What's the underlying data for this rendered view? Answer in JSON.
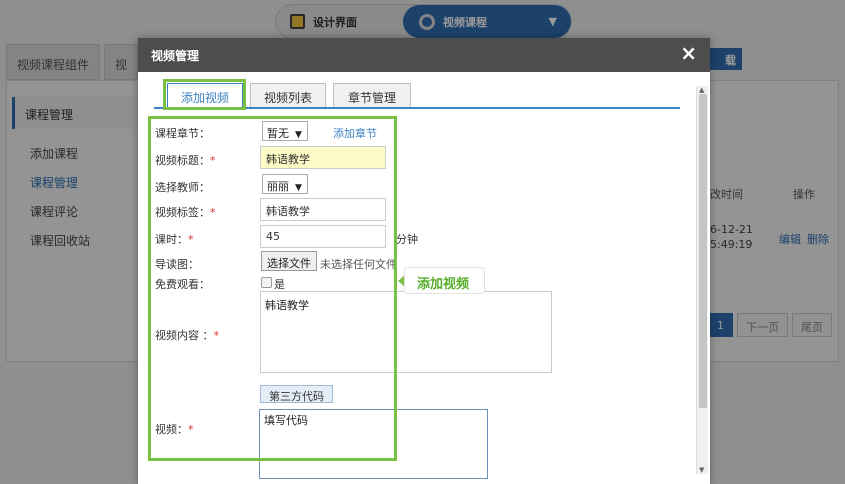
{
  "topbar": {
    "design_label": "设计界面",
    "course_label": "视频课程"
  },
  "bg": {
    "tabs": [
      "视频课程组件",
      "视"
    ],
    "download_label": "载",
    "sidebar_title": "课程管理",
    "sidebar_items": [
      "添加课程",
      "课程管理",
      "课程评论",
      "课程回收站"
    ],
    "col_time": "改时间",
    "col_ops": "操作",
    "row_date1": "6-12-21",
    "row_date2": "5:49:19",
    "edit": "编辑",
    "delete": "删除",
    "page_current": "1",
    "next": "下一页",
    "last": "尾页"
  },
  "modal": {
    "title": "视频管理",
    "close": "×",
    "tabs": [
      "添加视频",
      "视频列表",
      "章节管理"
    ]
  },
  "form": {
    "chapter_label": "课程章节：",
    "chapter_value": "暂无",
    "add_chapter": "添加章节",
    "title_label": "视频标题：",
    "title_value": "韩语教学",
    "teacher_label": "选择教师：",
    "teacher_value": "丽丽",
    "tags_label": "视频标签：",
    "tags_value": "韩语教学",
    "hours_label": "课时：",
    "hours_value": "45",
    "hours_unit": "分钟",
    "cover_label": "导读图：",
    "file_button": "选择文件",
    "file_none": "未选择任何文件",
    "free_label": "免费观看：",
    "free_option": "是",
    "content_label": "视频内容 ：",
    "content_value": "韩语教学",
    "code_button": "第三方代码",
    "video_label": "视频：",
    "video_value": "填写代码",
    "required_mark": "*"
  },
  "callout": {
    "text": "添加视频"
  }
}
